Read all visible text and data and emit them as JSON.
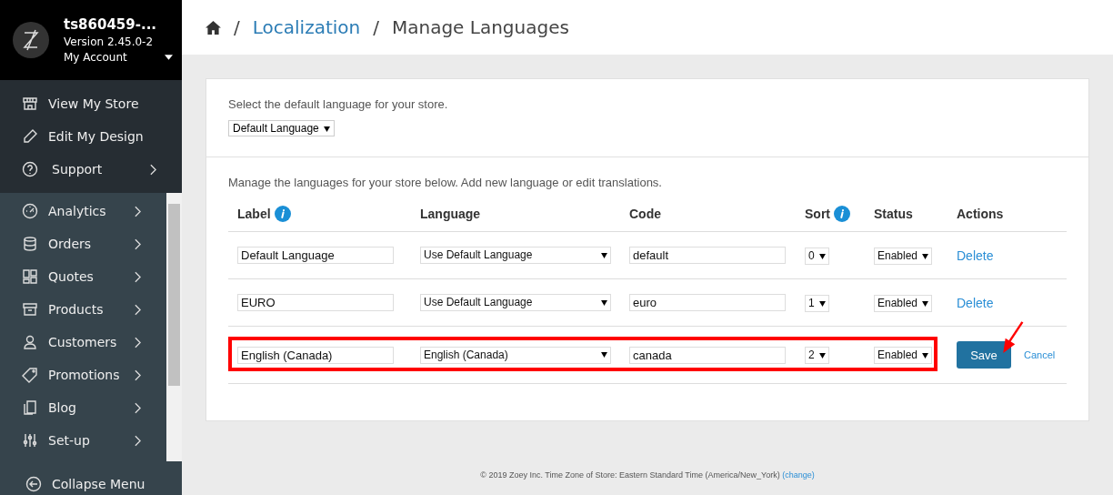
{
  "account": {
    "store": "ts860459-...",
    "version": "Version 2.45.0-2",
    "menu": "My Account"
  },
  "top_links": [
    {
      "label": "View My Store",
      "expandable": false
    },
    {
      "label": "Edit My Design",
      "expandable": false
    },
    {
      "label": "Support",
      "expandable": true
    }
  ],
  "nav": [
    {
      "label": "Analytics",
      "expandable": true
    },
    {
      "label": "Orders",
      "expandable": true
    },
    {
      "label": "Quotes",
      "expandable": true
    },
    {
      "label": "Products",
      "expandable": true
    },
    {
      "label": "Customers",
      "expandable": true
    },
    {
      "label": "Promotions",
      "expandable": true
    },
    {
      "label": "Blog",
      "expandable": true
    },
    {
      "label": "Set-up",
      "expandable": true
    }
  ],
  "collapse": "Collapse Menu",
  "breadcrumb": [
    "Localization",
    "Manage Languages"
  ],
  "breadcrumb_separator": "/",
  "default_section": {
    "text": "Select the default language for your store.",
    "select": "Default Language"
  },
  "languages": {
    "intro": "Manage the languages for your store below. Add new language or edit translations.",
    "columns": [
      {
        "label": "Label",
        "info": true
      },
      {
        "label": "Language",
        "info": false
      },
      {
        "label": "Code",
        "info": false
      },
      {
        "label": "Sort",
        "info": true
      },
      {
        "label": "Status",
        "info": false
      },
      {
        "label": "Actions",
        "info": false
      }
    ],
    "rows": [
      {
        "kind": "saved",
        "highlighted": false,
        "label": "Default Language",
        "language": "Use Default Language",
        "code": "default",
        "sort": "0",
        "status": "Enabled",
        "action": "Delete"
      },
      {
        "kind": "saved",
        "highlighted": false,
        "label": "EURO",
        "language": "Use Default Language",
        "code": "euro",
        "sort": "1",
        "status": "Enabled",
        "action": "Delete"
      },
      {
        "kind": "editing",
        "highlighted": true,
        "label": "English (Canada)",
        "language": "English (Canada)",
        "code": "canada",
        "sort": "2",
        "status": "Enabled",
        "save": "Save",
        "cancel": "Cancel"
      }
    ]
  },
  "footer": {
    "text": "© 2019 Zoey Inc. Time Zone of Store: Eastern Standard Time (America/New_York)",
    "link": "(change)"
  }
}
